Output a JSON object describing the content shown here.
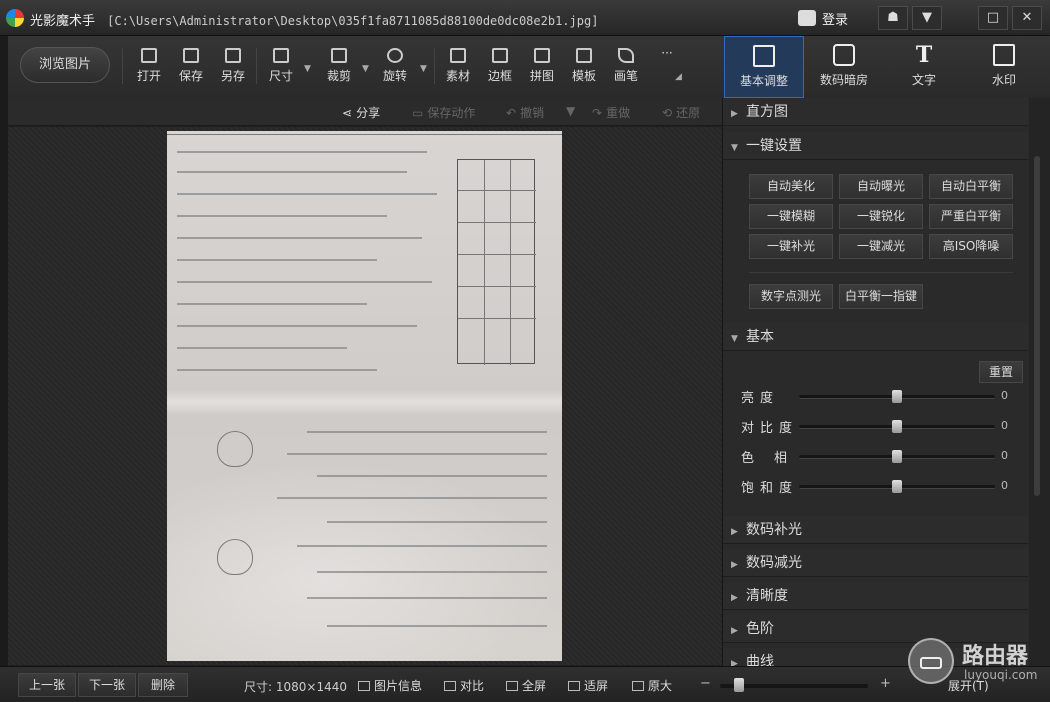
{
  "window": {
    "app_name": "光影魔术手",
    "file_path": "[C:\\Users\\Administrator\\Desktop\\035f1fa8711085d88100de0dc08e2b1.jpg]",
    "login_label": "登录",
    "controls": {
      "skin": "☗",
      "menu": "▼",
      "maximize": "□",
      "close": "✕"
    }
  },
  "toolbar": {
    "browse_label": "浏览图片",
    "tools": [
      {
        "label": "打开",
        "icon": "open-image-icon"
      },
      {
        "label": "保存",
        "icon": "save-icon"
      },
      {
        "label": "另存",
        "icon": "save-as-icon"
      },
      {
        "label": "尺寸",
        "icon": "resize-icon"
      },
      {
        "label": "裁剪",
        "icon": "crop-icon"
      },
      {
        "label": "旋转",
        "icon": "rotate-icon"
      },
      {
        "label": "素材",
        "icon": "material-icon"
      },
      {
        "label": "边框",
        "icon": "border-icon"
      },
      {
        "label": "拼图",
        "icon": "collage-icon"
      },
      {
        "label": "模板",
        "icon": "template-icon"
      },
      {
        "label": "画笔",
        "icon": "brush-icon"
      }
    ],
    "more_label": "···"
  },
  "right_tabs": [
    {
      "label": "基本调整",
      "icon": "adjust-icon",
      "active": true
    },
    {
      "label": "数码暗房",
      "icon": "darkroom-icon",
      "active": false
    },
    {
      "label": "文字",
      "icon": "text-icon",
      "active": false
    },
    {
      "label": "水印",
      "icon": "watermark-icon",
      "active": false
    }
  ],
  "subbar": {
    "share": "分享",
    "save_action": "保存动作",
    "undo": "撤销",
    "redo": "重做",
    "restore": "还原"
  },
  "panel": {
    "histogram": "直方图",
    "one_click": {
      "title": "一键设置",
      "buttons": [
        "自动美化",
        "自动曝光",
        "自动白平衡",
        "一键模糊",
        "一键锐化",
        "严重白平衡",
        "一键补光",
        "一键减光",
        "高ISO降噪"
      ],
      "extra_buttons": [
        "数字点测光",
        "白平衡一指键"
      ]
    },
    "basic": {
      "title": "基本",
      "reset_label": "重置",
      "sliders": [
        {
          "label": "亮度",
          "value": "0",
          "fraction": 0.5
        },
        {
          "label": "对比度",
          "value": "0",
          "fraction": 0.5
        },
        {
          "label": "色相",
          "value": "0",
          "fraction": 0.5
        },
        {
          "label": "饱和度",
          "value": "0",
          "fraction": 0.5
        }
      ]
    },
    "collapsed_sections": [
      "数码补光",
      "数码减光",
      "清晰度",
      "色阶",
      "曲线"
    ]
  },
  "bottombar": {
    "prev": "上一张",
    "next": "下一张",
    "delete": "删除",
    "size_info": "尺寸: 1080×1440",
    "image_info": "图片信息",
    "compare": "对比",
    "fullscreen": "全屏",
    "fit": "适屏",
    "original": "原大",
    "zoom_minus": "−",
    "zoom_plus": "+",
    "expand": "展开(T)"
  },
  "watermark": {
    "line1": "路由器",
    "line2": "luyouqi.com"
  }
}
